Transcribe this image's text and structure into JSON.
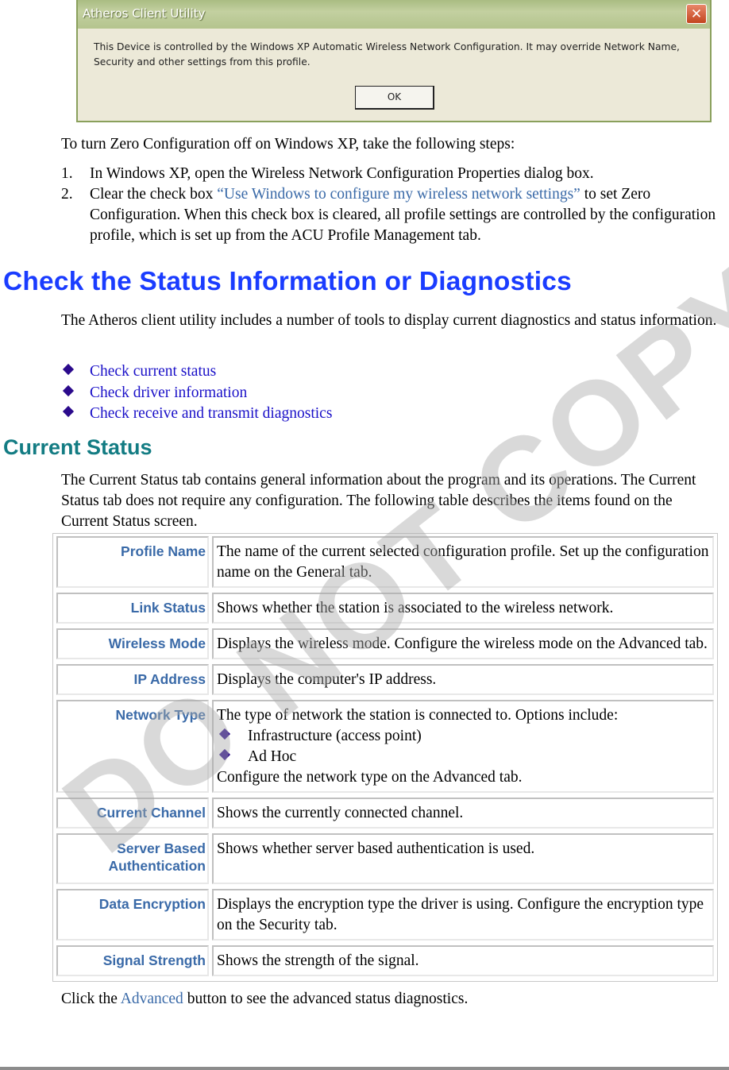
{
  "dialog": {
    "title": "Atheros Client Utility",
    "close_icon": "close-icon",
    "message": "This Device is controlled by the Windows XP Automatic Wireless Network Configuration. It may override Network Name, Security and other settings from this profile.",
    "ok_label": "OK"
  },
  "intro": "To turn Zero Configuration off on Windows XP, take the following steps:",
  "steps": [
    {
      "num": "1.",
      "text": "In Windows XP, open the Wireless Network Configuration Properties dialog box."
    },
    {
      "num": "2.",
      "pre": "Clear the check box ",
      "link": "“Use Windows to configure my wireless network settings”",
      "post": " to set Zero Configuration.  When this check box is cleared, all profile settings are controlled by the configuration profile, which is set up from the ACU Profile Management tab."
    }
  ],
  "heading1": "Check the Status Information or Diagnostics",
  "para1": "The Atheros client utility includes a number of tools to display current diagnostics and status information.",
  "bullet_icon": "diamond-bullet-icon",
  "links": [
    "Check current status",
    "Check driver information",
    "Check receive and transmit diagnostics"
  ],
  "heading2": "Current Status",
  "para2": "The Current Status tab contains general information about the program and its operations. The Current Status tab does not require any configuration. The following table describes the items found on the Current Status screen.",
  "table": [
    {
      "key": "Profile Name",
      "value": "The name of the current selected configuration profile.  Set up the configuration name on the General tab."
    },
    {
      "key": "Link Status",
      "value": "Shows whether the station is associated to the wireless network."
    },
    {
      "key": "Wireless Mode",
      "value": "Displays the wireless mode.  Configure the wireless mode on the Advanced tab."
    },
    {
      "key": "IP Address",
      "value": "Displays the computer's IP address."
    },
    {
      "key": "Network Type",
      "value": "The type of network the station is connected to.  Options include:",
      "options": [
        "Infrastructure (access point)",
        "Ad Hoc"
      ],
      "after": "Configure the network type on the Advanced tab."
    },
    {
      "key": "Current Channel",
      "value": "Shows the currently connected channel."
    },
    {
      "key": "Server Based Authentication",
      "key_lines": [
        "Server Based",
        "Authentication"
      ],
      "value": "Shows whether server based authentication is used."
    },
    {
      "key": "Data Encryption",
      "value": "Displays the encryption type the driver is using.   Configure the encryption type on the Security tab."
    },
    {
      "key": "Signal Strength",
      "value": "Shows the strength of the signal."
    }
  ],
  "closing": {
    "pre": "Click the ",
    "link": "Advanced",
    "post": " button to see the advanced status diagnostics."
  },
  "watermark": "DO NOT COPY"
}
